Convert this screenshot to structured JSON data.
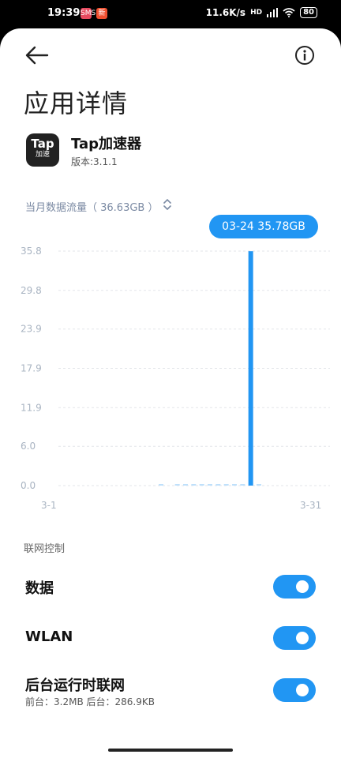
{
  "status_bar": {
    "time": "19:39",
    "badge1": "SMS",
    "badge2": "新",
    "speed": "11.6K/s",
    "signal": "HD",
    "battery": "80"
  },
  "header": {
    "title": "应用详情"
  },
  "app": {
    "icon_line1": "Tap",
    "icon_line2": "加速",
    "name": "Tap加速器",
    "version": "版本:3.1.1"
  },
  "usage": {
    "label": "当月数据流量（ 36.63GB ）",
    "tooltip": "03-24 35.78GB"
  },
  "chart_data": {
    "type": "bar",
    "y_ticks": [
      "35.8",
      "29.8",
      "23.9",
      "17.9",
      "11.9",
      "6.0",
      "0.0"
    ],
    "x_start_label": "3-1",
    "x_end_label": "3-31",
    "ylim": [
      0,
      35.8
    ],
    "days": [
      1,
      2,
      3,
      4,
      5,
      6,
      7,
      8,
      9,
      10,
      11,
      12,
      13,
      14,
      15,
      16,
      17,
      18,
      19,
      20,
      21,
      22,
      23,
      24,
      25,
      26,
      27,
      28,
      29,
      30,
      31
    ],
    "values": [
      0,
      0,
      0,
      0,
      0,
      0,
      0,
      0,
      0,
      0,
      0,
      0,
      0.05,
      0,
      0.05,
      0.05,
      0.05,
      0.05,
      0.05,
      0.05,
      0.1,
      0.05,
      0.05,
      35.78,
      0.05,
      0,
      0,
      0,
      0,
      0,
      0
    ],
    "highlight_day": 24,
    "color": "#2196f3",
    "grid": true
  },
  "network": {
    "section_title": "联网控制",
    "items": [
      {
        "label": "数据",
        "sub": "",
        "enabled": true
      },
      {
        "label": "WLAN",
        "sub": "",
        "enabled": true
      },
      {
        "label": "后台运行时联网",
        "sub": "前台：3.2MB  后台：286.9KB",
        "enabled": true
      }
    ]
  }
}
